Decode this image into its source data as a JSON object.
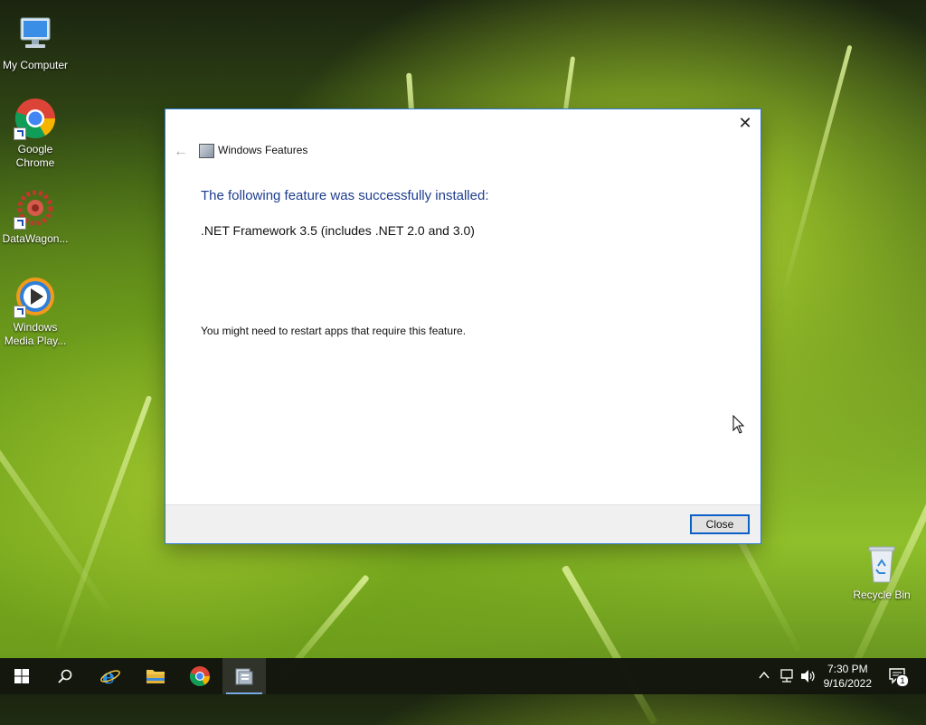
{
  "desktop": {
    "icons": [
      {
        "label": "My Computer",
        "icon": "computer-icon"
      },
      {
        "label": "Google Chrome",
        "icon": "chrome-icon"
      },
      {
        "label": "DataWagon...",
        "icon": "datawagon-icon"
      },
      {
        "label": "Windows Media Play...",
        "icon": "media-player-icon"
      },
      {
        "label": "Recycle Bin",
        "icon": "recycle-bin-icon"
      }
    ]
  },
  "dialog": {
    "title": "Windows Features",
    "heading": "The following feature was successfully installed:",
    "feature": ".NET Framework 3.5 (includes .NET 2.0 and 3.0)",
    "note": "You might need to restart apps that require this feature.",
    "close_button": "Close",
    "close_glyph": "✕",
    "back_glyph": "←"
  },
  "taskbar": {
    "clock_time": "7:30 PM",
    "clock_date": "9/16/2022",
    "notification_count": "1",
    "accent": "#77a9e3"
  }
}
